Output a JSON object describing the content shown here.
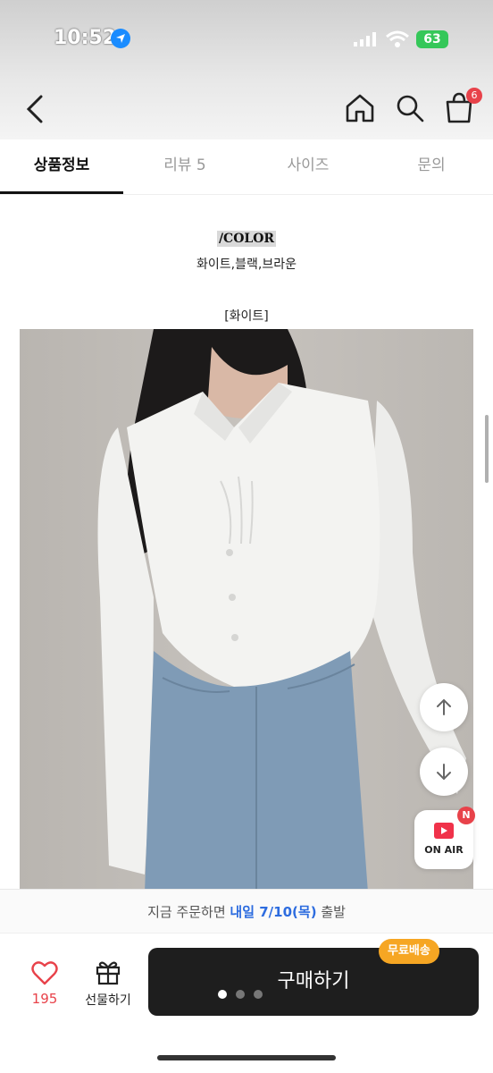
{
  "status_bar": {
    "time": "10:52",
    "battery": "63"
  },
  "header": {
    "icons": [
      "back-icon",
      "home-icon",
      "search-icon",
      "cart-icon"
    ],
    "cart_count": "6"
  },
  "tabs": [
    {
      "label": "상품정보",
      "active": true
    },
    {
      "label": "리뷰 5",
      "active": false
    },
    {
      "label": "사이즈",
      "active": false
    },
    {
      "label": "문의",
      "active": false
    }
  ],
  "content": {
    "color_heading": "/COLOR",
    "color_list": "화이트,블랙,브라운",
    "variant_label": "[화이트]"
  },
  "floating": {
    "onair_label": "ON AIR",
    "onair_badge": "N"
  },
  "delivery": {
    "prefix": "지금 주문하면 ",
    "highlight": "내일 7/10(목)",
    "suffix": " 출발"
  },
  "bottom_bar": {
    "like_count": "195",
    "gift_label": "선물하기",
    "buy_label": "구매하기",
    "free_shipping_badge": "무료배송"
  },
  "colors": {
    "accent_red": "#e8424a",
    "highlight_blue": "#2d6cdf",
    "badge_orange": "#f6a623",
    "buy_button": "#1e1e1e"
  }
}
